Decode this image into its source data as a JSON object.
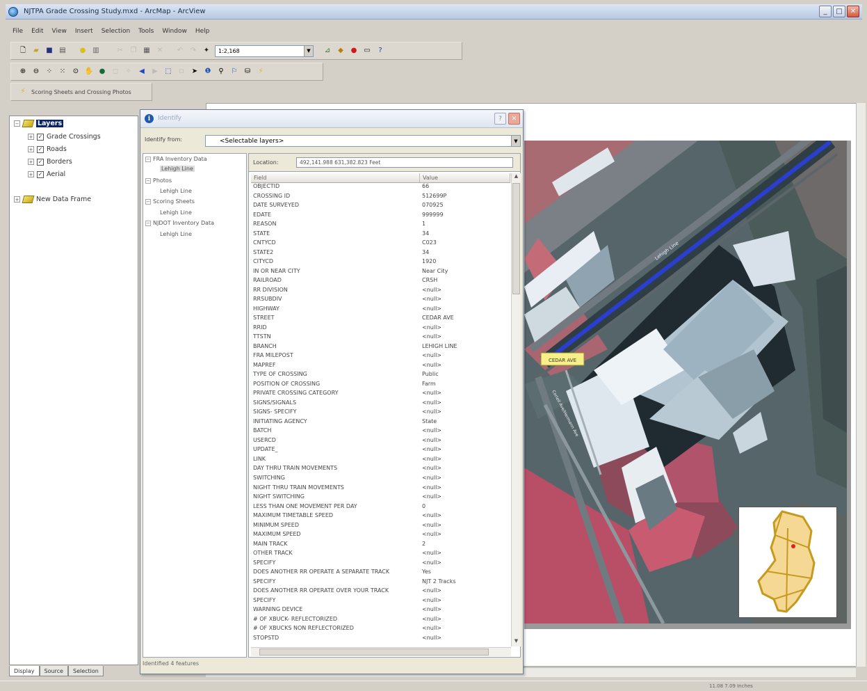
{
  "window": {
    "title": "NJTPA Grade Crossing Study.mxd - ArcMap - ArcView",
    "min": "_",
    "max": "□",
    "close": "✕"
  },
  "menu": [
    "File",
    "Edit",
    "View",
    "Insert",
    "Selection",
    "Tools",
    "Window",
    "Help"
  ],
  "toolbar": {
    "scale": "1:2,168",
    "custom_label": "Scoring Sheets and Crossing Photos"
  },
  "toc": {
    "root": "Layers",
    "layers": [
      "Grade Crossings",
      "Roads",
      "Borders",
      "Aerial"
    ],
    "frame2": "New Data Frame",
    "tabs": [
      "Display",
      "Source",
      "Selection"
    ]
  },
  "identify": {
    "title": "Identify",
    "help": "?",
    "close": "✕",
    "identify_from_label": "Identify from:",
    "identify_from_value": "<Selectable layers>",
    "location_label": "Location:",
    "location_value": "492,141.988 631,382.823 Feet",
    "tree": [
      {
        "label": "FRA Inventory Data",
        "child": "Lehigh Line"
      },
      {
        "label": "Photos",
        "child": "Lehigh Line"
      },
      {
        "label": "Scoring Sheets",
        "child": "Lehigh Line"
      },
      {
        "label": "NJDOT Inventory Data",
        "child": "Lehigh Line"
      }
    ],
    "col_field": "Field",
    "col_value": "Value",
    "rows": [
      [
        "OBJECTID",
        "66"
      ],
      [
        "CROSSING ID",
        "512699P"
      ],
      [
        "DATE SURVEYED",
        "070925"
      ],
      [
        "EDATE",
        "999999"
      ],
      [
        "REASON",
        "1"
      ],
      [
        "STATE",
        "34"
      ],
      [
        "CNTYCD",
        "C023"
      ],
      [
        "STATE2",
        "34"
      ],
      [
        "CITYCD",
        "1920"
      ],
      [
        "IN OR NEAR CITY",
        "Near City"
      ],
      [
        "RAILROAD",
        "CRSH"
      ],
      [
        "RR DIVISION",
        "<null>"
      ],
      [
        "RRSUBDIV",
        "<null>"
      ],
      [
        "HIGHWAY",
        "<null>"
      ],
      [
        "STREET",
        "CEDAR AVE"
      ],
      [
        "RRID",
        "<null>"
      ],
      [
        "TTSTN",
        "<null>"
      ],
      [
        "BRANCH",
        "LEHIGH LINE"
      ],
      [
        "FRA MILEPOST",
        "<null>"
      ],
      [
        "MAPREF",
        "<null>"
      ],
      [
        "TYPE OF CROSSING",
        "Public"
      ],
      [
        "POSITION OF CROSSING",
        "Farm"
      ],
      [
        "PRIVATE CROSSING CATEGORY",
        "<null>"
      ],
      [
        "SIGNS/SIGNALS",
        "<null>"
      ],
      [
        "SIGNS- SPECIFY",
        "<null>"
      ],
      [
        "INITIATING AGENCY",
        "State"
      ],
      [
        "BATCH",
        "<null>"
      ],
      [
        "USERCD",
        "<null>"
      ],
      [
        "UPDATE_",
        "<null>"
      ],
      [
        "LINK",
        "<null>"
      ],
      [
        "DAY THRU TRAIN MOVEMENTS",
        "<null>"
      ],
      [
        "SWITCHING",
        "<null>"
      ],
      [
        "NIGHT THRU TRAIN MOVEMENTS",
        "<null>"
      ],
      [
        "NIGHT SWITCHING",
        "<null>"
      ],
      [
        "LESS THAN ONE MOVEMENT PER DAY",
        "0"
      ],
      [
        "MAXIMUM TIMETABLE SPEED",
        "<null>"
      ],
      [
        "MINIMUM SPEED",
        "<null>"
      ],
      [
        "MAXIMUM SPEED",
        "<null>"
      ],
      [
        "MAIN TRACK",
        "2"
      ],
      [
        "OTHER TRACK",
        "<null>"
      ],
      [
        "SPECIFY",
        "<null>"
      ],
      [
        "DOES ANOTHER RR OPERATE A SEPARATE TRACK",
        "Yes"
      ],
      [
        "SPECIFY",
        "NJT 2 Tracks"
      ],
      [
        "DOES ANOTHER RR OPERATE OVER YOUR TRACK",
        "<null>"
      ],
      [
        "SPECIFY",
        "<null>"
      ],
      [
        "WARNING DEVICE",
        "<null>"
      ],
      [
        "# OF XBUCK- REFLECTORIZED",
        "<null>"
      ],
      [
        "# OF XBUCKS NON REFLECTORIZED",
        "<null>"
      ],
      [
        "STOPSTD",
        "<null>"
      ]
    ],
    "status": "Identified 4 features"
  },
  "map": {
    "label_street": "CEDAR AVE",
    "label_rail": "Lehigh Line",
    "label_road2": "Coriell Ave/Hermann Ave"
  },
  "statusbar": {
    "coords": "11.08  7.09 Inches"
  },
  "colors": {
    "titlebar": "#c7d5ec",
    "rail": "#2a3fd0",
    "inset_state": "#f4d893"
  }
}
